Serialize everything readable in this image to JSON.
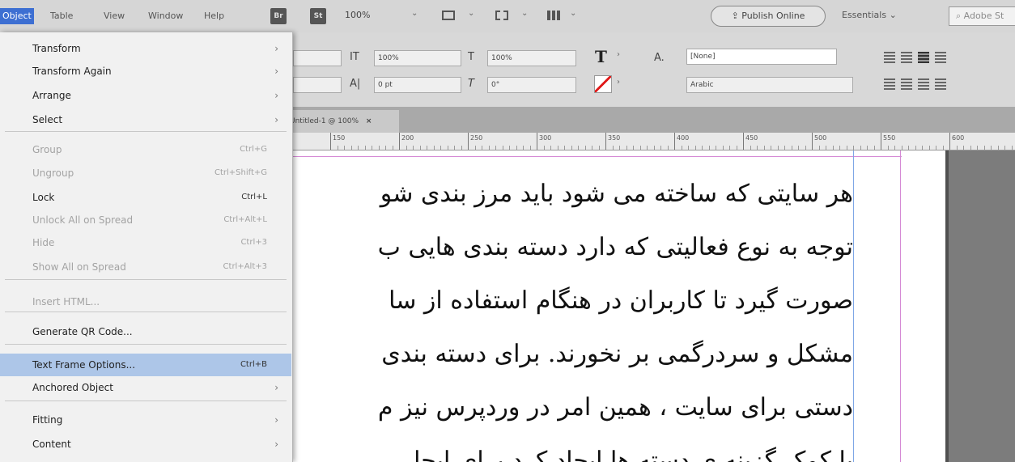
{
  "menubar": {
    "active_menu": "Object",
    "items": [
      "Table",
      "View",
      "Window",
      "Help"
    ],
    "badges": [
      "Br",
      "St"
    ],
    "zoom": "100%",
    "publish_label": "Publish Online",
    "workspace": "Essentials",
    "search_placeholder": "Adobe St"
  },
  "control": {
    "vscale": "100%",
    "hscale": "100%",
    "tracking": "0 pt",
    "skew": "0°",
    "char_style": "[None]",
    "language": "Arabic",
    "baseline_label": "A."
  },
  "document": {
    "tab_title": "Untitled-1 @ 100%",
    "tab_close": "×",
    "ruler_labels": [
      "150",
      "200",
      "250",
      "300",
      "350",
      "400",
      "450",
      "500",
      "550",
      "600"
    ],
    "lines": [
      "هر سایتی که ساخته می شود باید مرز بندی شو",
      "توجه به نوع فعالیتی که دارد دسته بندی هایی ب",
      "صورت گیرد تا کاربران در هنگام استفاده از سا",
      "مشکل و سردرگمی بر نخورند. برای  دسته بندی",
      "دستی برای سایت ، همین امر در وردپرس نیز م",
      "با کمک گزینه ی  دسته ها ایجاد کرد برای ایجا"
    ]
  },
  "menu": {
    "items": [
      {
        "label": "Transform",
        "shortcut": "",
        "submenu": true,
        "disabled": false
      },
      {
        "label": "Transform Again",
        "shortcut": "",
        "submenu": true,
        "disabled": false
      },
      {
        "label": "Arrange",
        "shortcut": "",
        "submenu": true,
        "disabled": false
      },
      {
        "label": "Select",
        "shortcut": "",
        "submenu": true,
        "disabled": false
      },
      {
        "label": "Group",
        "shortcut": "Ctrl+G",
        "submenu": false,
        "disabled": true
      },
      {
        "label": "Ungroup",
        "shortcut": "Ctrl+Shift+G",
        "submenu": false,
        "disabled": true
      },
      {
        "label": "Lock",
        "shortcut": "Ctrl+L",
        "submenu": false,
        "disabled": false
      },
      {
        "label": "Unlock All on Spread",
        "shortcut": "Ctrl+Alt+L",
        "submenu": false,
        "disabled": true
      },
      {
        "label": "Hide",
        "shortcut": "Ctrl+3",
        "submenu": false,
        "disabled": true
      },
      {
        "label": "Show All on Spread",
        "shortcut": "Ctrl+Alt+3",
        "submenu": false,
        "disabled": true
      },
      {
        "label": "Insert HTML...",
        "shortcut": "",
        "submenu": false,
        "disabled": true
      },
      {
        "label": "Generate QR Code...",
        "shortcut": "",
        "submenu": false,
        "disabled": false
      },
      {
        "label": "Text Frame Options...",
        "shortcut": "Ctrl+B",
        "submenu": false,
        "disabled": false,
        "highlighted": true
      },
      {
        "label": "Anchored Object",
        "shortcut": "",
        "submenu": true,
        "disabled": false
      },
      {
        "label": "Fitting",
        "shortcut": "",
        "submenu": true,
        "disabled": false
      },
      {
        "label": "Content",
        "shortcut": "",
        "submenu": true,
        "disabled": false
      }
    ]
  },
  "colors": {
    "menu_highlight": "#adc6e8",
    "active_menu_bg": "#3d6fd2",
    "margin_guide": "#d58ad5",
    "frame_edge": "#7fa7e6"
  }
}
